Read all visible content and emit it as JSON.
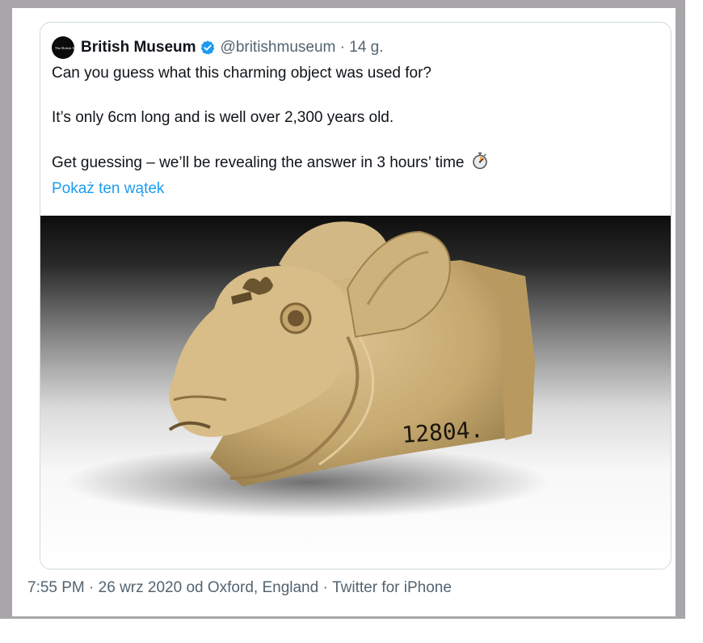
{
  "tweet": {
    "avatar_text": "The British Museum",
    "author_name": "British Museum",
    "handle": "@britishmuseum",
    "separator": " · ",
    "age": "14 g.",
    "line1": "Can you guess what this charming object was used for?",
    "line2": "It’s only 6cm long and is well over 2,300 years old.",
    "line3": "Get guessing – we’ll be revealing the answer in 3 hours’ time",
    "thread_link": "Pokaż ten wątek",
    "object_number": "12804."
  },
  "meta": {
    "time": "7:55 PM",
    "sep1": " · ",
    "date": "26 wrz 2020",
    "from": " od ",
    "location": "Oxford, England",
    "sep2": " · ",
    "client": "Twitter for iPhone"
  },
  "icons": {
    "verified": "verified-badge-icon",
    "stopwatch": "stopwatch-icon"
  },
  "colors": {
    "link": "#1d9bf0",
    "verified": "#1d9bf0",
    "secondary_text": "#536471",
    "frame": "#a8a6a9"
  }
}
